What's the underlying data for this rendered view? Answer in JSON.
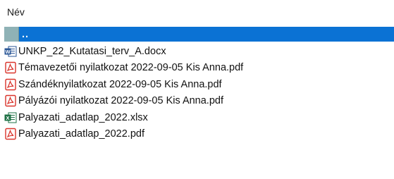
{
  "header": {
    "column_name": "Név"
  },
  "files": [
    {
      "name": "..",
      "icon": "folder-up-icon",
      "selected": true
    },
    {
      "name": "UNKP_22_Kutatasi_terv_A.docx",
      "icon": "word-doc-icon",
      "selected": false
    },
    {
      "name": "Témavezetői nyilatkozat 2022-09-05 Kis Anna.pdf",
      "icon": "pdf-icon",
      "selected": false
    },
    {
      "name": "Szándéknyilatkozat 2022-09-05 Kis Anna.pdf",
      "icon": "pdf-icon",
      "selected": false
    },
    {
      "name": "Pályázói nyilatkozat 2022-09-05 Kis Anna.pdf",
      "icon": "pdf-icon",
      "selected": false
    },
    {
      "name": "Palyazati_adatlap_2022.xlsx",
      "icon": "excel-doc-icon",
      "selected": false
    },
    {
      "name": "Palyazati_adatlap_2022.pdf",
      "icon": "pdf-icon",
      "selected": false
    }
  ],
  "colors": {
    "selection": "#0b72d4",
    "pdf_red": "#d9342b",
    "word_blue": "#2b5797",
    "excel_green": "#1e7145"
  }
}
